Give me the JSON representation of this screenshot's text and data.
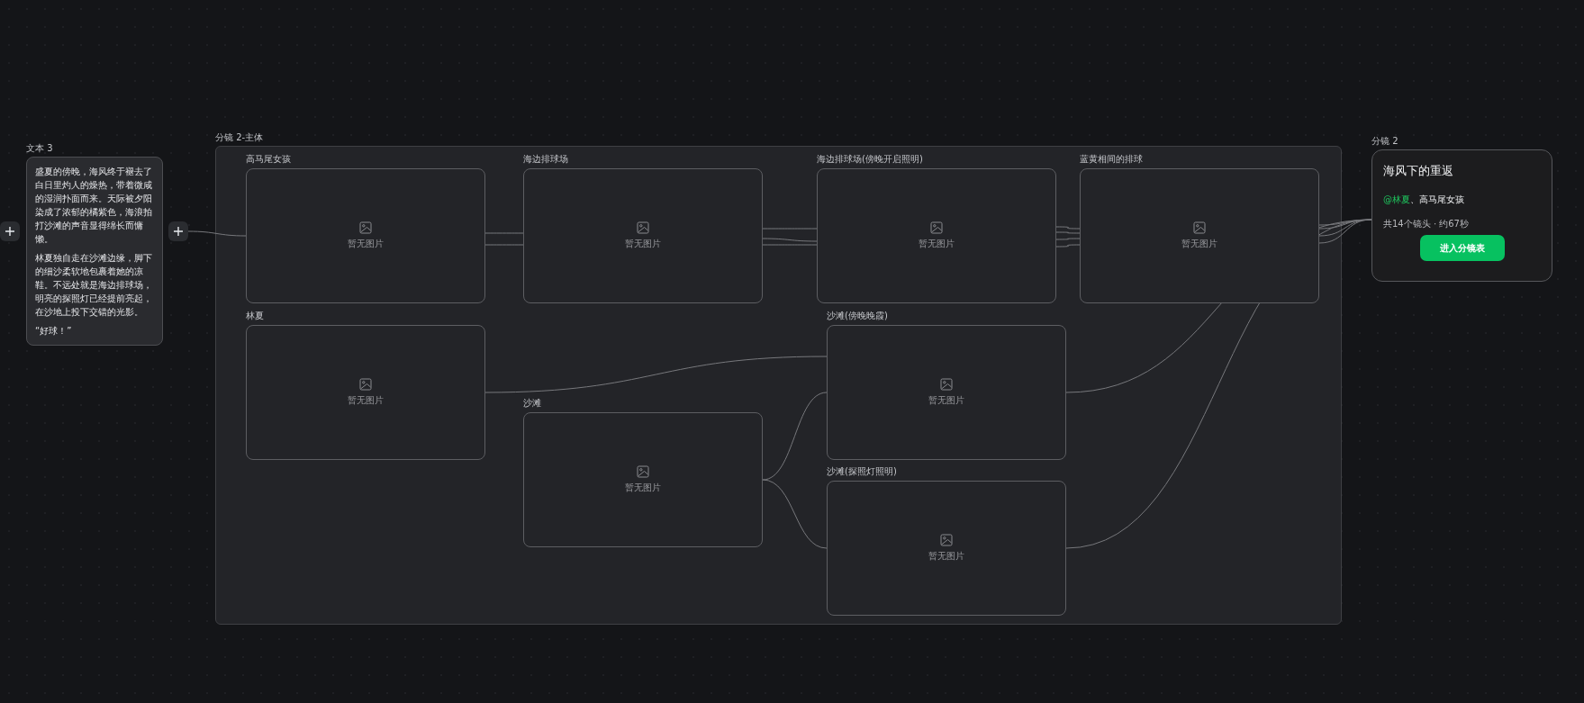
{
  "text_card": {
    "label": "文本 3",
    "paragraphs": [
      "盛夏的傍晚，海风终于褪去了白日里灼人的燥热，带着微咸的湿润扑面而来。天际被夕阳染成了浓郁的橘紫色，海浪拍打沙滩的声音显得绵长而慵懒。",
      "林夏独自走在沙滩边缘，脚下的细沙柔软地包裹着她的凉鞋。不远处就是海边排球场，明亮的探照灯已经提前亮起，在沙地上投下交错的光影。",
      "“好球！”"
    ]
  },
  "group": {
    "label": "分镜 2-主体",
    "nodes": [
      {
        "title": "高马尾女孩",
        "placeholder": "暂无图片"
      },
      {
        "title": "海边排球场",
        "placeholder": "暂无图片"
      },
      {
        "title": "海边排球场(傍晚开启照明)",
        "placeholder": "暂无图片"
      },
      {
        "title": "蓝黄相间的排球",
        "placeholder": "暂无图片"
      },
      {
        "title": "林夏",
        "placeholder": "暂无图片"
      },
      {
        "title": "沙滩",
        "placeholder": "暂无图片"
      },
      {
        "title": "沙滩(傍晚晚霞)",
        "placeholder": "暂无图片"
      },
      {
        "title": "沙滩(探照灯照明)",
        "placeholder": "暂无图片"
      }
    ]
  },
  "scene_card": {
    "label": "分镜 2",
    "title": "海风下的重返",
    "characters": [
      {
        "text": "@林夏",
        "highlighted": true
      },
      {
        "text": "、",
        "highlighted": false
      },
      {
        "text": "高马尾女孩",
        "highlighted": false
      }
    ],
    "summary": "共14个镜头 · 约67秒",
    "button": "进入分镜表"
  }
}
